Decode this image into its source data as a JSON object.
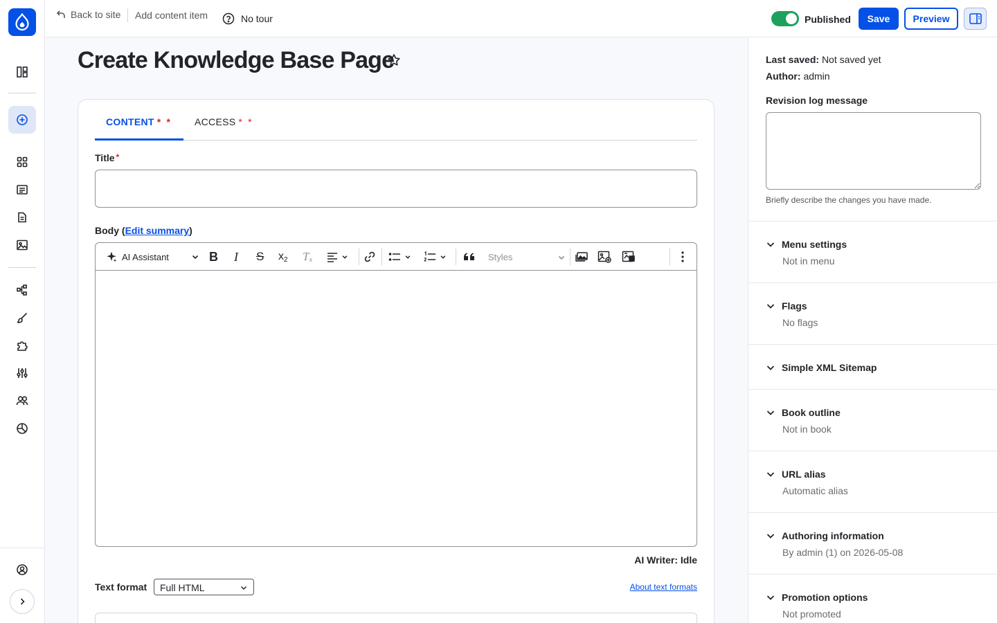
{
  "topbar": {
    "back_label": "Back to site",
    "breadcrumb": "Add content item",
    "tour_label": "No tour",
    "status_label": "Published",
    "save_label": "Save",
    "preview_label": "Preview"
  },
  "page": {
    "title": "Create Knowledge Base Page"
  },
  "tabs": [
    {
      "label": "CONTENT",
      "required": "*",
      "required2": "*",
      "active": true
    },
    {
      "label": "ACCESS",
      "required": "*",
      "required2": "*",
      "active": false
    }
  ],
  "form": {
    "title_label": "Title",
    "title_required": "*",
    "title_value": "",
    "body_label": "Body",
    "body_edit_summary": "Edit summary",
    "body_paren_open": "(",
    "body_paren_close": ")",
    "ai_writer_status": "AI Writer: Idle",
    "text_format_label": "Text format",
    "text_format_value": "Full HTML",
    "about_text_formats": "About text formats"
  },
  "editor_toolbar": {
    "ai_assistant": "AI Assistant",
    "styles_placeholder": "Styles"
  },
  "sidebar": {
    "last_saved_label": "Last saved:",
    "last_saved_value": "Not saved yet",
    "author_label": "Author:",
    "author_value": "admin",
    "revision_label": "Revision log message",
    "revision_help": "Briefly describe the changes you have made.",
    "sections": [
      {
        "title": "Menu settings",
        "summary": "Not in menu"
      },
      {
        "title": "Flags",
        "summary": "No flags"
      },
      {
        "title": "Simple XML Sitemap",
        "summary": ""
      },
      {
        "title": "Book outline",
        "summary": "Not in book"
      },
      {
        "title": "URL alias",
        "summary": "Automatic alias"
      },
      {
        "title": "Authoring information",
        "summary": "By admin (1) on 2026-05-08"
      },
      {
        "title": "Promotion options",
        "summary": "Not promoted"
      }
    ]
  },
  "colors": {
    "primary": "#0550e6",
    "published_toggle": "#1ea15c",
    "required": "#d72222"
  }
}
